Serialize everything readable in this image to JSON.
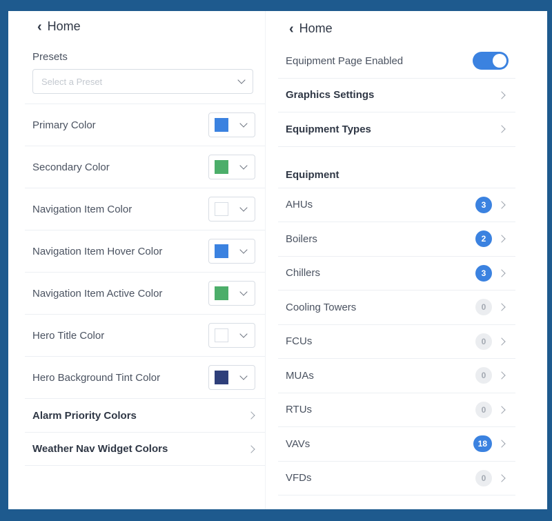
{
  "left": {
    "back_label": "Home",
    "presets_label": "Presets",
    "preset_placeholder": "Select a Preset",
    "color_rows": [
      {
        "label": "Primary Color",
        "swatch": "#3b82e0"
      },
      {
        "label": "Secondary Color",
        "swatch": "#4cae6a"
      },
      {
        "label": "Navigation Item Color",
        "swatch": "#ffffff"
      },
      {
        "label": "Navigation Item Hover Color",
        "swatch": "#3b82e0"
      },
      {
        "label": "Navigation Item Active Color",
        "swatch": "#4cae6a"
      },
      {
        "label": "Hero Title Color",
        "swatch": "#ffffff"
      },
      {
        "label": "Hero Background Tint Color",
        "swatch": "#2e3f7a"
      }
    ],
    "link_rows": [
      {
        "label": "Alarm Priority Colors"
      },
      {
        "label": "Weather Nav Widget Colors"
      }
    ]
  },
  "right": {
    "back_label": "Home",
    "equipment_page_label": "Equipment Page Enabled",
    "equipment_page_enabled": true,
    "graphics_settings_label": "Graphics Settings",
    "equipment_types_label": "Equipment Types",
    "equipment_heading": "Equipment",
    "equipment": [
      {
        "label": "AHUs",
        "count": "3"
      },
      {
        "label": "Boilers",
        "count": "2"
      },
      {
        "label": "Chillers",
        "count": "3"
      },
      {
        "label": "Cooling Towers",
        "count": "0"
      },
      {
        "label": "FCUs",
        "count": "0"
      },
      {
        "label": "MUAs",
        "count": "0"
      },
      {
        "label": "RTUs",
        "count": "0"
      },
      {
        "label": "VAVs",
        "count": "18"
      },
      {
        "label": "VFDs",
        "count": "0"
      }
    ]
  },
  "colors": {
    "border": "#1e5a8e",
    "accent": "#3b82e0",
    "green": "#4cae6a"
  }
}
